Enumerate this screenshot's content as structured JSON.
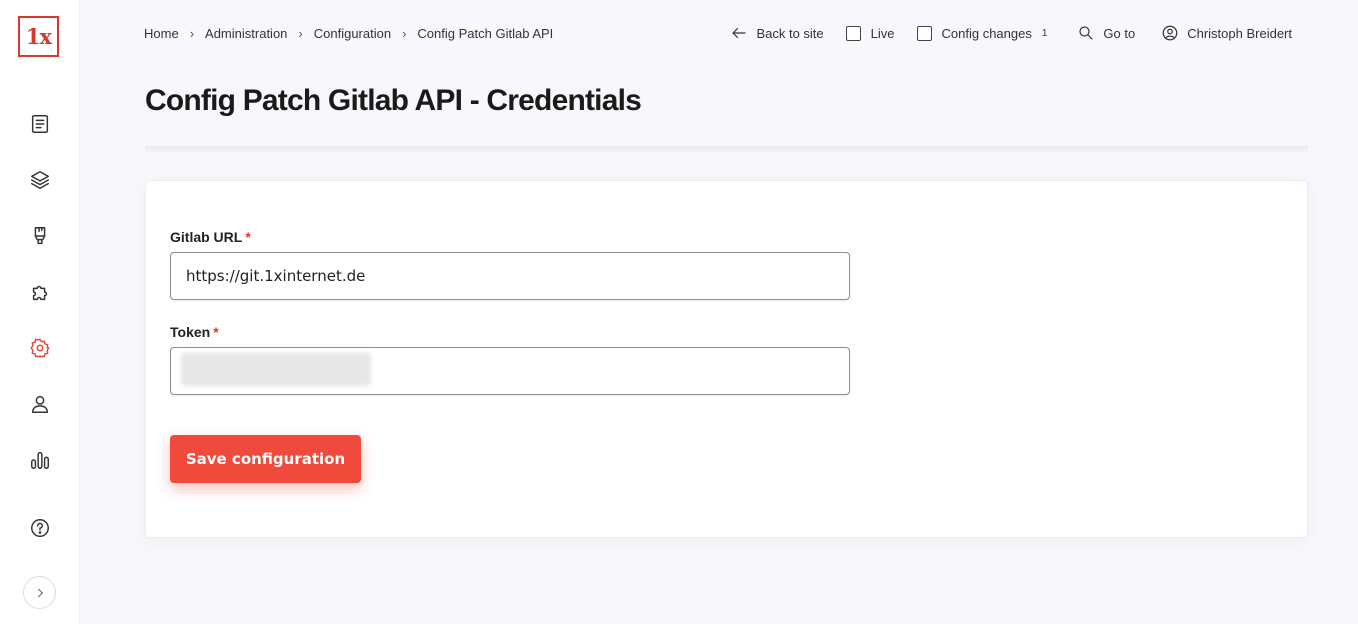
{
  "app": {
    "logo_text": "1x",
    "accent_color": "#f04a3d",
    "logo_color": "#d9382e"
  },
  "sidebar": {
    "items": [
      {
        "icon": "content-icon",
        "label": "Content"
      },
      {
        "icon": "layers-icon",
        "label": "Structure"
      },
      {
        "icon": "appearance-icon",
        "label": "Appearance"
      },
      {
        "icon": "extend-icon",
        "label": "Extend"
      },
      {
        "icon": "gear-icon",
        "label": "Configuration",
        "active": true
      },
      {
        "icon": "user-icon",
        "label": "People"
      },
      {
        "icon": "reports-icon",
        "label": "Reports"
      },
      {
        "icon": "help-icon",
        "label": "Help"
      }
    ],
    "collapse_icon": "chevron-right-icon"
  },
  "breadcrumb": {
    "items": [
      "Home",
      "Administration",
      "Configuration",
      "Config Patch Gitlab API"
    ],
    "separator": "›"
  },
  "topbar": {
    "back_label": "Back to site",
    "live_label": "Live",
    "config_changes_label": "Config changes",
    "config_changes_count": "1",
    "goto_label": "Go to",
    "user_name": "Christoph Breidert"
  },
  "page": {
    "title": "Config Patch Gitlab API - Credentials"
  },
  "form": {
    "gitlab_url": {
      "label": "Gitlab URL",
      "required_mark": "*",
      "value": "https://git.1xinternet.de"
    },
    "token": {
      "label": "Token",
      "required_mark": "*",
      "value": ""
    },
    "save_label": "Save configuration"
  }
}
